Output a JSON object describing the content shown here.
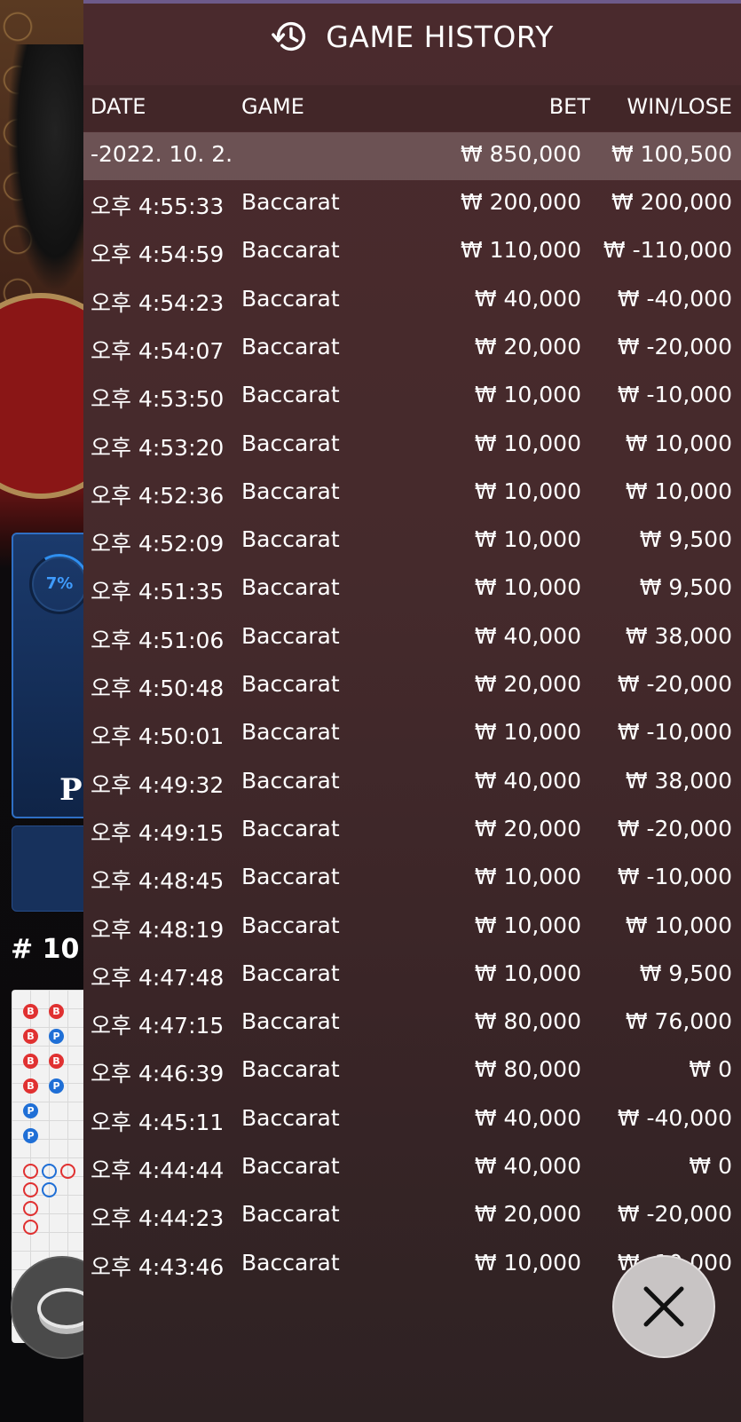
{
  "background": {
    "percent": "7%",
    "player_letter": "P",
    "round": "# 10",
    "road": {
      "row1": [
        "B",
        "B"
      ],
      "row2": [
        "B",
        "P"
      ],
      "row3": [
        "B",
        "B"
      ],
      "row4": [
        "B",
        "P"
      ],
      "row5": [
        "P"
      ],
      "row6": [
        "P"
      ]
    }
  },
  "history": {
    "title": "GAME HISTORY",
    "columns": {
      "date": "DATE",
      "game": "GAME",
      "bet": "BET",
      "win": "WIN/LOSE"
    },
    "date_summary": {
      "date": "-2022. 10. 2.",
      "bet": "₩ 850,000",
      "win": "₩ 100,500"
    },
    "rows": [
      {
        "time": "오후 4:55:33",
        "game": "Baccarat",
        "bet": "₩ 200,000",
        "win": "₩ 200,000"
      },
      {
        "time": "오후 4:54:59",
        "game": "Baccarat",
        "bet": "₩ 110,000",
        "win": "₩ -110,000"
      },
      {
        "time": "오후 4:54:23",
        "game": "Baccarat",
        "bet": "₩ 40,000",
        "win": "₩ -40,000"
      },
      {
        "time": "오후 4:54:07",
        "game": "Baccarat",
        "bet": "₩ 20,000",
        "win": "₩ -20,000"
      },
      {
        "time": "오후 4:53:50",
        "game": "Baccarat",
        "bet": "₩ 10,000",
        "win": "₩ -10,000"
      },
      {
        "time": "오후 4:53:20",
        "game": "Baccarat",
        "bet": "₩ 10,000",
        "win": "₩ 10,000"
      },
      {
        "time": "오후 4:52:36",
        "game": "Baccarat",
        "bet": "₩ 10,000",
        "win": "₩ 10,000"
      },
      {
        "time": "오후 4:52:09",
        "game": "Baccarat",
        "bet": "₩ 10,000",
        "win": "₩ 9,500"
      },
      {
        "time": "오후 4:51:35",
        "game": "Baccarat",
        "bet": "₩ 10,000",
        "win": "₩ 9,500"
      },
      {
        "time": "오후 4:51:06",
        "game": "Baccarat",
        "bet": "₩ 40,000",
        "win": "₩ 38,000"
      },
      {
        "time": "오후 4:50:48",
        "game": "Baccarat",
        "bet": "₩ 20,000",
        "win": "₩ -20,000"
      },
      {
        "time": "오후 4:50:01",
        "game": "Baccarat",
        "bet": "₩ 10,000",
        "win": "₩ -10,000"
      },
      {
        "time": "오후 4:49:32",
        "game": "Baccarat",
        "bet": "₩ 40,000",
        "win": "₩ 38,000"
      },
      {
        "time": "오후 4:49:15",
        "game": "Baccarat",
        "bet": "₩ 20,000",
        "win": "₩ -20,000"
      },
      {
        "time": "오후 4:48:45",
        "game": "Baccarat",
        "bet": "₩ 10,000",
        "win": "₩ -10,000"
      },
      {
        "time": "오후 4:48:19",
        "game": "Baccarat",
        "bet": "₩ 10,000",
        "win": "₩ 10,000"
      },
      {
        "time": "오후 4:47:48",
        "game": "Baccarat",
        "bet": "₩ 10,000",
        "win": "₩ 9,500"
      },
      {
        "time": "오후 4:47:15",
        "game": "Baccarat",
        "bet": "₩ 80,000",
        "win": "₩ 76,000"
      },
      {
        "time": "오후 4:46:39",
        "game": "Baccarat",
        "bet": "₩ 80,000",
        "win": "₩ 0"
      },
      {
        "time": "오후 4:45:11",
        "game": "Baccarat",
        "bet": "₩ 40,000",
        "win": "₩ -40,000"
      },
      {
        "time": "오후 4:44:44",
        "game": "Baccarat",
        "bet": "₩ 40,000",
        "win": "₩ 0"
      },
      {
        "time": "오후 4:44:23",
        "game": "Baccarat",
        "bet": "₩ 20,000",
        "win": "₩ -20,000"
      },
      {
        "time": "오후 4:43:46",
        "game": "Baccarat",
        "bet": "₩ 10,000",
        "win": "₩ -10,000"
      }
    ]
  },
  "colors": {
    "overlay": "#452a2c",
    "date_row": "#8a7a7c",
    "accent_blue": "#2f8ff0"
  }
}
